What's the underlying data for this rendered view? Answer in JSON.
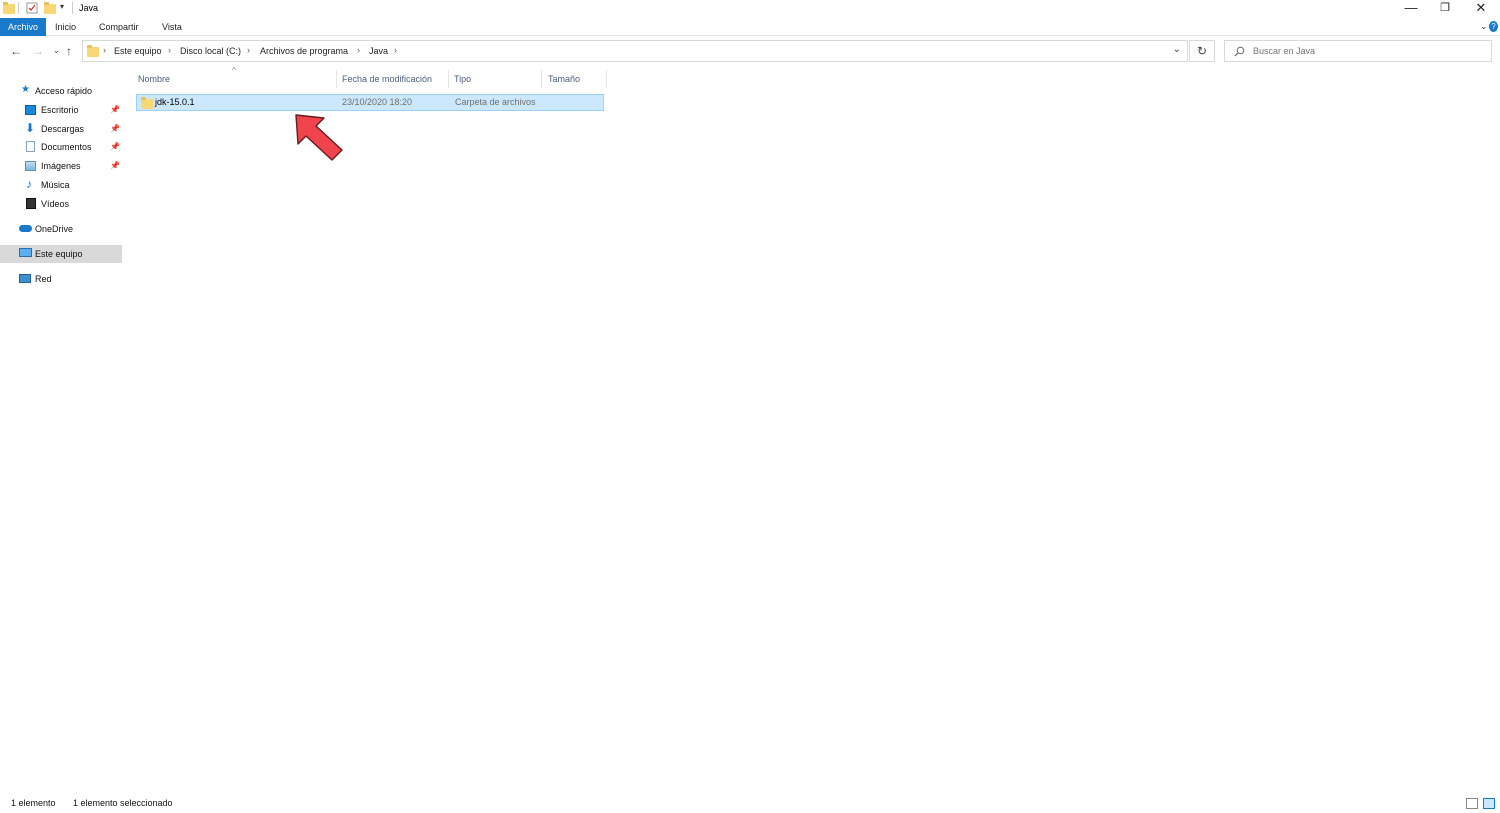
{
  "window": {
    "title": "Java",
    "minimize": "—",
    "restore": "❐",
    "close": "✕"
  },
  "ribbon": {
    "tabs": [
      "Archivo",
      "Inicio",
      "Compartir",
      "Vista"
    ]
  },
  "address": {
    "crumbs": [
      "Este equipo",
      "Disco local (C:)",
      "Archivos de programa",
      "Java"
    ],
    "separator": "›"
  },
  "search": {
    "placeholder": "Buscar en Java"
  },
  "nav_pane": {
    "quick_access": "Acceso rápido",
    "items": [
      "Escritorio",
      "Descargas",
      "Documentos",
      "Imágenes",
      "Música",
      "Vídeos"
    ],
    "onedrive": "OneDrive",
    "this_pc": "Este equipo",
    "network": "Red"
  },
  "columns": {
    "name": "Nombre",
    "modified": "Fecha de modificación",
    "type": "Tipo",
    "size": "Tamaño"
  },
  "files": [
    {
      "name": "jdk-15.0.1",
      "modified": "23/10/2020 18:20",
      "type": "Carpeta de archivos",
      "size": ""
    }
  ],
  "status": {
    "count": "1 elemento",
    "selection": "1 elemento seleccionado"
  },
  "colors": {
    "accent": "#1979ca",
    "selection_bg": "#cce8ff",
    "selection_border": "#99d1ff",
    "annotation_arrow": "#f0444c",
    "folder": "#f8d775"
  }
}
